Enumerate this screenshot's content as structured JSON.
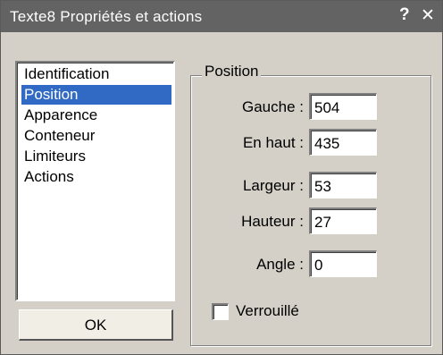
{
  "window": {
    "title": "Texte8 Propriétés et actions",
    "help_glyph": "?",
    "close_glyph": "✕"
  },
  "sidebar": {
    "items": [
      {
        "label": "Identification",
        "selected": false
      },
      {
        "label": "Position",
        "selected": true
      },
      {
        "label": "Apparence",
        "selected": false
      },
      {
        "label": "Conteneur",
        "selected": false
      },
      {
        "label": "Limiteurs",
        "selected": false
      },
      {
        "label": "Actions",
        "selected": false
      }
    ],
    "ok_label": "OK"
  },
  "position_group": {
    "title": "Position",
    "fields": {
      "gauche": {
        "label": "Gauche :",
        "value": "504"
      },
      "en_haut": {
        "label": "En haut :",
        "value": "435"
      },
      "largeur": {
        "label": "Largeur :",
        "value": "53"
      },
      "hauteur": {
        "label": "Hauteur :",
        "value": "27"
      },
      "angle": {
        "label": "Angle :",
        "value": "0"
      }
    },
    "lock": {
      "label": "Verrouillé",
      "checked": false
    }
  },
  "colors": {
    "titlebar": "#636363",
    "dialog_face": "#d4d0c8",
    "selection": "#316ac5"
  }
}
